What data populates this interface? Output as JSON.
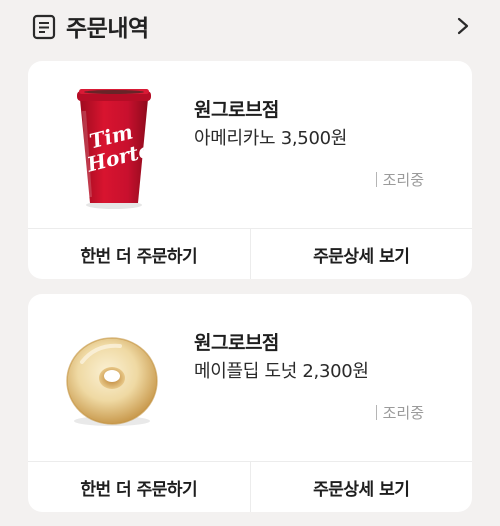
{
  "header": {
    "title": "주문내역",
    "icon": "receipt-list-icon",
    "more_icon": "chevron-right-icon"
  },
  "orders": [
    {
      "store": "원그로브점",
      "item": "아메리카노 3,500원",
      "status": "조리중",
      "image_icon": "tim-hortons-cup-image",
      "cup_logo_text": "Tim Hortons",
      "actions": {
        "reorder": "한번 더 주문하기",
        "detail": "주문상세 보기"
      }
    },
    {
      "store": "원그로브점",
      "item": "메이플딥 도넛 2,300원",
      "status": "조리중",
      "image_icon": "maple-dip-donut-image",
      "actions": {
        "reorder": "한번 더 주문하기",
        "detail": "주문상세 보기"
      }
    }
  ],
  "colors": {
    "background": "#f3f1f0",
    "card": "#ffffff",
    "cup_red": "#c8102e",
    "status_gray": "#9b9b9b"
  }
}
